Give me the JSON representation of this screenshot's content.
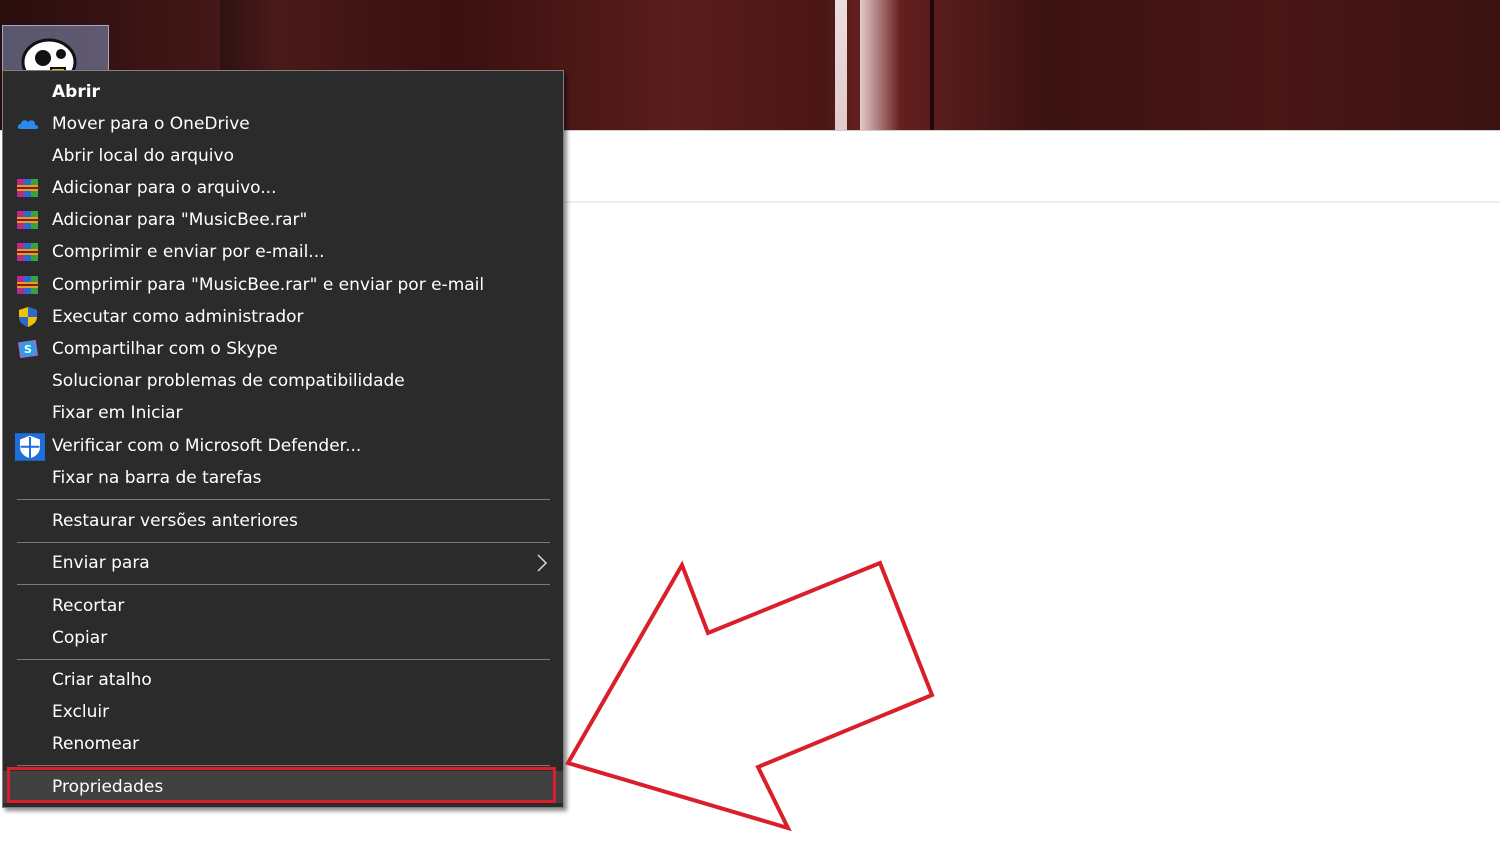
{
  "menu": {
    "items": [
      {
        "label": "Abrir",
        "icon": "",
        "bold": true
      },
      {
        "label": "Mover para o OneDrive",
        "icon": "onedrive-icon"
      },
      {
        "label": "Abrir local do arquivo",
        "icon": ""
      },
      {
        "label": "Adicionar para o arquivo...",
        "icon": "winrar-icon"
      },
      {
        "label": "Adicionar para \"MusicBee.rar\"",
        "icon": "winrar-icon"
      },
      {
        "label": "Comprimir e enviar por e-mail...",
        "icon": "winrar-icon"
      },
      {
        "label": "Comprimir para \"MusicBee.rar\" e enviar por e-mail",
        "icon": "winrar-icon"
      },
      {
        "label": "Executar como administrador",
        "icon": "uac-shield-icon"
      },
      {
        "label": "Compartilhar com o Skype",
        "icon": "skype-icon"
      },
      {
        "label": "Solucionar problemas de compatibilidade",
        "icon": ""
      },
      {
        "label": "Fixar em Iniciar",
        "icon": ""
      },
      {
        "label": "Verificar com o Microsoft Defender...",
        "icon": "defender-icon"
      },
      {
        "label": "Fixar na barra de tarefas",
        "icon": ""
      },
      {
        "label": "Restaurar versões anteriores",
        "icon": ""
      },
      {
        "label": "Enviar para",
        "icon": "",
        "submenu": true
      },
      {
        "label": "Recortar",
        "icon": ""
      },
      {
        "label": "Copiar",
        "icon": ""
      },
      {
        "label": "Criar atalho",
        "icon": ""
      },
      {
        "label": "Excluir",
        "icon": ""
      },
      {
        "label": "Renomear",
        "icon": ""
      },
      {
        "label": "Propriedades",
        "icon": "",
        "highlighted": true
      }
    ]
  },
  "desktop_icon": {
    "icon": "musicbee-icon"
  },
  "colors": {
    "menu_background": "#2b2b2b",
    "menu_text": "#ffffff",
    "annotation_red": "#d9202a"
  }
}
